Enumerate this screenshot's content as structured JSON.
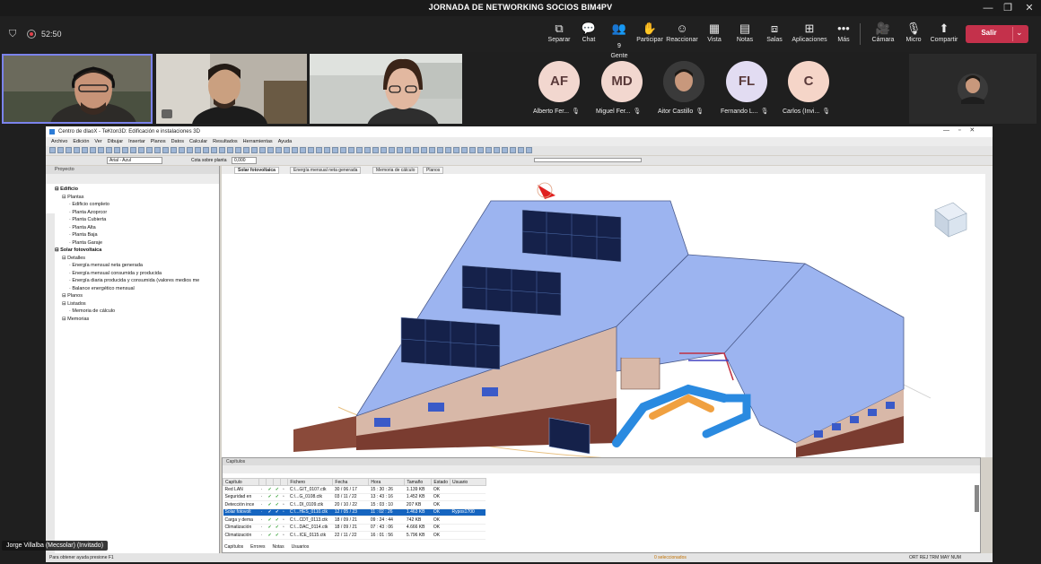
{
  "meeting": {
    "title": "JORNADA DE NETWORKING SOCIOS BIM4PV",
    "timer": "52:50",
    "toolbar": [
      {
        "icon": "share-screen-icon",
        "glyph": "⧉",
        "label": "Separar"
      },
      {
        "icon": "chat-icon",
        "glyph": "💬",
        "label": "Chat"
      },
      {
        "icon": "people-icon",
        "glyph": "👥",
        "label": "Gente",
        "badge": "9"
      },
      {
        "icon": "raise-hand-icon",
        "glyph": "✋",
        "label": "Participar"
      },
      {
        "icon": "react-icon",
        "glyph": "☺",
        "label": "Reaccionar"
      },
      {
        "icon": "view-icon",
        "glyph": "▦",
        "label": "Vista"
      },
      {
        "icon": "notes-icon",
        "glyph": "▤",
        "label": "Notas"
      },
      {
        "icon": "rooms-icon",
        "glyph": "⧈",
        "label": "Salas"
      },
      {
        "icon": "apps-icon",
        "glyph": "⊞",
        "label": "Aplicaciones"
      },
      {
        "icon": "more-icon",
        "glyph": "•••",
        "label": "Más"
      },
      {
        "icon": "camera-off-icon",
        "glyph": "🎥",
        "label": "Cámara"
      },
      {
        "icon": "mic-off-icon",
        "glyph": "🎙",
        "label": "Micro"
      },
      {
        "icon": "share-icon",
        "glyph": "⬆",
        "label": "Compartir"
      }
    ],
    "leave_label": "Salir",
    "participants": [
      {
        "initials": "AF",
        "name": "Alberto Fer...",
        "color": "#f2d7cf"
      },
      {
        "initials": "MD",
        "name": "Miguel Fer...",
        "color": "#f2d7cf"
      },
      {
        "initials": "",
        "name": "Aitor Castillo",
        "color": "#3a3a3a"
      },
      {
        "initials": "FL",
        "name": "Fernando L...",
        "color": "#e2dcf2"
      },
      {
        "initials": "C",
        "name": "Carlos (Invi...",
        "color": "#f5d5c8"
      }
    ],
    "presenter_name": "Jorge Villalba (Mecsolar) (Invitado)"
  },
  "app": {
    "window_title": "Centro de dlaoX - TeKton3D: Edificación e instalaciones 3D",
    "menu": [
      "Archivo",
      "Edición",
      "Ver",
      "Dibujar",
      "Insertar",
      "Planos",
      "Datos",
      "Calcular",
      "Resultados",
      "Herramientas",
      "Ayuda"
    ],
    "font_select": "Arial - Azul",
    "floor_label": "Cota sobre planta",
    "floor_value": "0,000",
    "project_panel_title": "Proyecto",
    "tree": [
      {
        "label": "Edificio",
        "indent": 0,
        "bold": true
      },
      {
        "label": "Plantas",
        "indent": 1,
        "bold": false
      },
      {
        "label": "Edificio completo",
        "indent": 2,
        "bold": false
      },
      {
        "label": "Planta Azoprcor",
        "indent": 2,
        "bold": false
      },
      {
        "label": "Planta Cubierta",
        "indent": 2,
        "bold": false
      },
      {
        "label": "Planta Alta",
        "indent": 2,
        "bold": false
      },
      {
        "label": "Planta Baja",
        "indent": 2,
        "bold": false
      },
      {
        "label": "Planta Garaje",
        "indent": 2,
        "bold": false
      },
      {
        "label": "Solar fotovoltaica",
        "indent": 0,
        "bold": true
      },
      {
        "label": "Detalles",
        "indent": 1,
        "bold": false
      },
      {
        "label": "Energía mensual neta generada",
        "indent": 2,
        "bold": false
      },
      {
        "label": "Energía mensual consumida y producida",
        "indent": 2,
        "bold": false
      },
      {
        "label": "Energía diaria producida y consumida (valores medios me",
        "indent": 2,
        "bold": false
      },
      {
        "label": "Balance energético mensual",
        "indent": 2,
        "bold": false
      },
      {
        "label": "Planos",
        "indent": 1,
        "bold": false
      },
      {
        "label": "Listados",
        "indent": 1,
        "bold": false
      },
      {
        "label": "Memoria de cálculo",
        "indent": 2,
        "bold": false
      },
      {
        "label": "Memorias",
        "indent": 1,
        "bold": false
      }
    ],
    "tabs": [
      "Solar fotovoltaica",
      "Energía mensual neta generada",
      "Memoria de cálculo",
      "Planos"
    ],
    "capitulos_title": "Capítulos",
    "table_headers": [
      "Capítulo",
      "",
      "",
      "",
      "",
      "Fichero",
      "Fecha",
      "Hora",
      "Tamaño",
      "Estado",
      "Usuario"
    ],
    "table_rows": [
      {
        "cap": "Red LAN",
        "file": "C:\\...GIT_0107.ctk",
        "date": "30 / 06 / 17",
        "time": "15 : 30 : 26",
        "size": "1.139 KB",
        "state": "OK",
        "user": "",
        "sel": false
      },
      {
        "cap": "Seguridad en",
        "file": "C:\\...G_0108.ctk",
        "date": "03 / 11 / 22",
        "time": "13 : 43 : 16",
        "size": "1.452 KB",
        "state": "OK",
        "user": "",
        "sel": false
      },
      {
        "cap": "Detección ince",
        "file": "C:\\...DI_0109.ctk",
        "date": "20 / 10 / 22",
        "time": "15 : 03 : 10",
        "size": "207 KB",
        "state": "OK",
        "user": "",
        "sel": false
      },
      {
        "cap": "Solar fotovolt",
        "file": "C:\\...HES_0110.ctk",
        "date": "12 / 05 / 23",
        "time": "11 : 02 : 26",
        "size": "1.463 KB",
        "state": "OK",
        "user": "Rypos1700",
        "sel": true
      },
      {
        "cap": "Carga y dema",
        "file": "C:\\...CDT_0113.ctk",
        "date": "18 / 09 / 21",
        "time": "09 : 24 : 44",
        "size": "742 KB",
        "state": "OK",
        "user": "",
        "sel": false
      },
      {
        "cap": "Climatización",
        "file": "C:\\...DAC_0114.ctk",
        "date": "18 / 09 / 21",
        "time": "07 : 43 : 06",
        "size": "4.666 KB",
        "state": "OK",
        "user": "",
        "sel": false
      },
      {
        "cap": "Climatización",
        "file": "C:\\...ICE_0115.ctk",
        "date": "22 / 11 / 22",
        "time": "16 : 01 : 56",
        "size": "5.796 KB",
        "state": "OK",
        "user": "",
        "sel": false
      }
    ],
    "bottom_tabs": [
      "Capítulos",
      "Errores",
      "Notas",
      "Usuarios"
    ],
    "status_hint": "Para obtener ayuda presione F1",
    "status_selected": "0 seleccionados",
    "status_keys": "ORT REJ TRM MAY NUM"
  }
}
